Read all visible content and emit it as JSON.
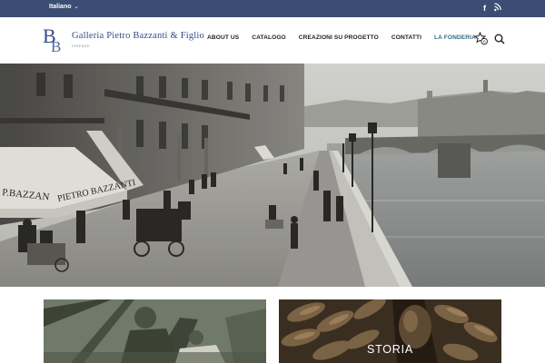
{
  "topbar": {
    "language": "Italiano",
    "social_icons": [
      "facebook-icon",
      "rss-icon"
    ]
  },
  "header": {
    "brand": "Galleria Pietro Bazzanti & Figlio",
    "tagline": "FIRENZE",
    "nav": [
      {
        "label": "ABOUT US"
      },
      {
        "label": "CATALOGO"
      },
      {
        "label": "CREAZIONI SU PROGETTO"
      },
      {
        "label": "CONTATTI"
      },
      {
        "label": "LA FONDERIA"
      }
    ],
    "icons": [
      "favorites-icon",
      "search-icon"
    ]
  },
  "hero": {
    "sign_texts": [
      "P.BAZZAN",
      "PIETRO BAZZANTI"
    ]
  },
  "tiles": [
    {
      "label": ""
    },
    {
      "label": "STORIA"
    }
  ],
  "colors": {
    "topbar": "#3b4d72",
    "brand": "#2f4f86",
    "nav_active": "#2c6e82"
  }
}
